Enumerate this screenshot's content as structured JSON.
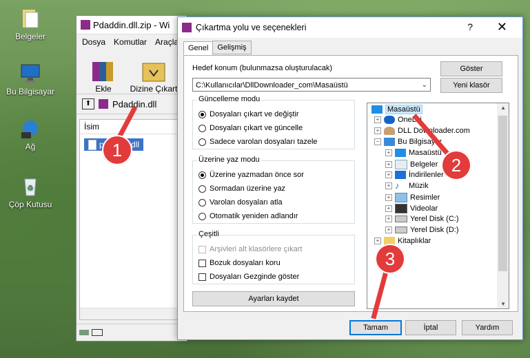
{
  "desktop": {
    "icons": [
      {
        "label": "Belgeler",
        "icon": "folder-icon"
      },
      {
        "label": "Bu Bilgisayar",
        "icon": "computer-icon"
      },
      {
        "label": "Ağ",
        "icon": "network-icon"
      },
      {
        "label": "Çöp Kutusu",
        "icon": "recycle-bin-icon"
      }
    ]
  },
  "winrar": {
    "title": "Pdaddin.dll.zip - Wi",
    "menu": [
      "Dosya",
      "Komutlar",
      "Araçla"
    ],
    "tools": [
      {
        "label": "Ekle"
      },
      {
        "label": "Dizine Çıkart"
      }
    ],
    "path": "Pdaddin.dll",
    "column": "İsim",
    "file": "pdaddin.dll"
  },
  "dialog": {
    "title": "Çıkartma yolu ve seçenekleri",
    "help": "?",
    "close": "✕",
    "tabs": [
      "Genel",
      "Gelişmiş"
    ],
    "target_label": "Hedef konum (bulunmazsa oluşturulacak)",
    "target_value": "C:\\Kullanıcılar\\DllDownloader_com\\Masaüstü",
    "show_button": "Göster",
    "new_folder_button": "Yeni klasör",
    "update_mode": {
      "title": "Güncelleme modu",
      "options": [
        "Dosyaları çıkart ve değiştir",
        "Dosyaları çıkart ve güncelle",
        "Sadece varolan dosyaları tazele"
      ],
      "selected": 0
    },
    "overwrite_mode": {
      "title": "Üzerine yaz modu",
      "options": [
        "Üzerine yazmadan önce sor",
        "Sormadan üzerine yaz",
        "Varolan dosyaları atla",
        "Otomatik yeniden adlandır"
      ],
      "selected": 0
    },
    "misc": {
      "title": "Çeşitli",
      "options": [
        "Arşivleri alt klasörlere çıkart",
        "Bozuk dosyaları koru",
        "Dosyaları Gezginde göster"
      ]
    },
    "save_settings_button": "Ayarları kaydet",
    "tree": [
      {
        "label": "Masaüstü",
        "icon": "desktop-icon"
      },
      {
        "label": "OneDri",
        "icon": "onedrive-icon"
      },
      {
        "label": "DLL Downloader.com",
        "icon": "user-icon"
      },
      {
        "label": "Bu Bilgisayar",
        "icon": "computer-icon"
      },
      {
        "label": "Masaüstü",
        "icon": "desktop-icon"
      },
      {
        "label": "Belgeler",
        "icon": "documents-icon"
      },
      {
        "label": "İndirilenler",
        "icon": "downloads-icon"
      },
      {
        "label": "Müzik",
        "icon": "music-icon"
      },
      {
        "label": "Resimler",
        "icon": "pictures-icon"
      },
      {
        "label": "Videolar",
        "icon": "videos-icon"
      },
      {
        "label": "Yerel Disk (C:)",
        "icon": "drive-icon"
      },
      {
        "label": "Yerel Disk (D:)",
        "icon": "drive-icon"
      },
      {
        "label": "Kitaplıklar",
        "icon": "libraries-icon"
      }
    ],
    "ok_button": "Tamam",
    "cancel_button": "İptal",
    "help_button": "Yardım"
  },
  "markers": [
    "1",
    "2",
    "3"
  ],
  "colors": {
    "marker": "#e23b3b",
    "selection": "#3b73c9",
    "default_button_border": "#0078d7"
  }
}
